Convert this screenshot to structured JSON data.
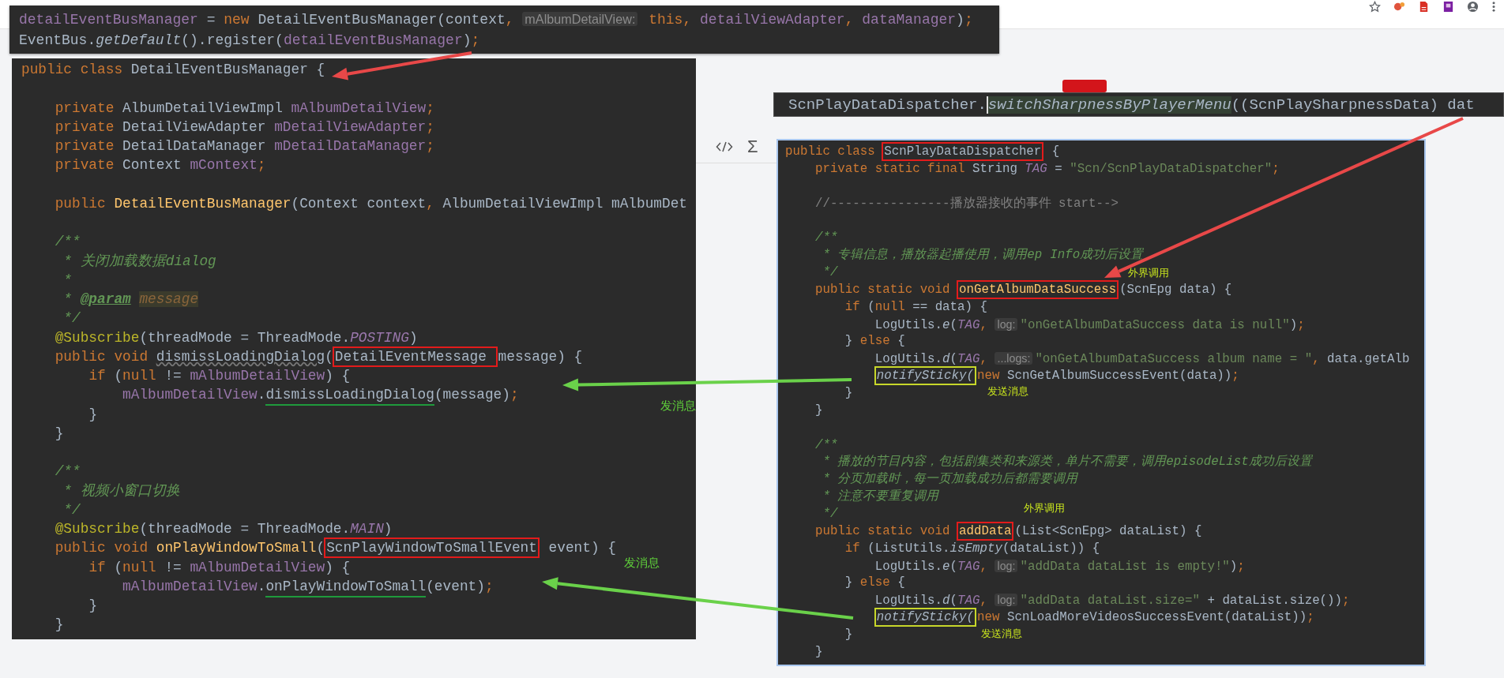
{
  "top_snippet": {
    "lines": [
      {
        "kind": "code",
        "tokens": [
          {
            "text": "detailEventBusManager",
            "kind": "field"
          },
          {
            "text": " = ",
            "kind": "plain"
          },
          {
            "text": "new ",
            "kind": "kw"
          },
          {
            "text": "DetailEventBusManager(context",
            "kind": "plain"
          },
          {
            "text": ", ",
            "kind": "kw"
          },
          {
            "text": "mAlbumDetailView:",
            "kind": "hint"
          },
          {
            "text": " this, ",
            "kind": "kw"
          },
          {
            "text": "detailViewAdapter",
            "kind": "field"
          },
          {
            "text": ", ",
            "kind": "kw"
          },
          {
            "text": "dataManager",
            "kind": "field"
          },
          {
            "text": ")",
            "kind": "plain"
          },
          {
            "text": ";",
            "kind": "kw"
          }
        ]
      },
      {
        "kind": "code",
        "tokens": [
          {
            "text": "EventBus.",
            "kind": "plain"
          },
          {
            "text": "getDefault",
            "kind": "italic"
          },
          {
            "text": "().register(",
            "kind": "plain"
          },
          {
            "text": "detailEventBusManager",
            "kind": "field"
          },
          {
            "text": ")",
            "kind": "plain"
          },
          {
            "text": ";",
            "kind": "kw"
          }
        ]
      }
    ]
  },
  "editor_toolbar": {
    "sigma": "Σ"
  },
  "call_snippet": {
    "tokens": [
      {
        "text": "ScnPlayDataDispatcher.",
        "kind": "plain"
      },
      {
        "text": "switchSharpnessByPlayerMenu",
        "kind": "selected"
      },
      {
        "text": "((ScnPlaySharpnessData) dat",
        "kind": "plain"
      }
    ]
  },
  "code_panels": [
    {
      "lines": [
        {
          "kind": "code",
          "tokens": [
            {
              "text": "public class ",
              "kind": "kw"
            },
            {
              "text": "DetailEventBusManager {",
              "kind": "plain"
            }
          ]
        },
        {
          "kind": "blank"
        },
        {
          "kind": "code",
          "tokens": [
            {
              "text": "    private ",
              "kind": "kw"
            },
            {
              "text": "AlbumDetailViewImpl ",
              "kind": "plain"
            },
            {
              "text": "mAlbumDetailView",
              "kind": "field"
            },
            {
              "text": ";",
              "kind": "kw"
            }
          ]
        },
        {
          "kind": "code",
          "tokens": [
            {
              "text": "    private ",
              "kind": "kw"
            },
            {
              "text": "DetailViewAdapter ",
              "kind": "plain"
            },
            {
              "text": "mDetailViewAdapter",
              "kind": "field"
            },
            {
              "text": ";",
              "kind": "kw"
            }
          ]
        },
        {
          "kind": "code",
          "tokens": [
            {
              "text": "    private ",
              "kind": "kw"
            },
            {
              "text": "DetailDataManager ",
              "kind": "plain"
            },
            {
              "text": "mDetailDataManager",
              "kind": "field"
            },
            {
              "text": ";",
              "kind": "kw"
            }
          ]
        },
        {
          "kind": "code",
          "tokens": [
            {
              "text": "    private ",
              "kind": "kw"
            },
            {
              "text": "Context ",
              "kind": "plain"
            },
            {
              "text": "mContext",
              "kind": "field"
            },
            {
              "text": ";",
              "kind": "kw"
            }
          ]
        },
        {
          "kind": "blank"
        },
        {
          "kind": "code",
          "tokens": [
            {
              "text": "    public ",
              "kind": "kw"
            },
            {
              "text": "DetailEventBusManager",
              "kind": "method"
            },
            {
              "text": "(Context context",
              "kind": "plain"
            },
            {
              "text": ", ",
              "kind": "kw"
            },
            {
              "text": "AlbumDetailViewImpl mAlbumDet",
              "kind": "plain"
            }
          ]
        },
        {
          "kind": "blank"
        },
        {
          "kind": "code",
          "tokens": [
            {
              "text": "    /**",
              "kind": "doc"
            }
          ]
        },
        {
          "kind": "code",
          "tokens": [
            {
              "text": "     * 关闭加载数据dialog",
              "kind": "doc"
            }
          ]
        },
        {
          "kind": "code",
          "tokens": [
            {
              "text": "     *",
              "kind": "doc"
            }
          ]
        },
        {
          "kind": "code",
          "tokens": [
            {
              "text": "     * ",
              "kind": "doc"
            },
            {
              "text": "@param",
              "kind": "doctag"
            },
            {
              "text": "message",
              "kind": "docparam"
            }
          ]
        },
        {
          "kind": "code",
          "tokens": [
            {
              "text": "     */",
              "kind": "doc"
            }
          ]
        },
        {
          "kind": "code",
          "tokens": [
            {
              "text": "    @Subscribe",
              "kind": "annot"
            },
            {
              "text": "(threadMode = ThreadMode.",
              "kind": "plain"
            },
            {
              "text": "POSTING",
              "kind": "static"
            },
            {
              "text": ")",
              "kind": "plain"
            }
          ]
        },
        {
          "kind": "code",
          "tokens": [
            {
              "text": "    public void ",
              "kind": "kw"
            },
            {
              "text": "dismissLoadingDialog",
              "kind": "unused"
            },
            {
              "text": "(",
              "kind": "plain"
            },
            {
              "text": "DetailEventMessage ",
              "kind": "plain",
              "color": "#e31b1b"
            },
            {
              "text": "message) {",
              "kind": "plain"
            }
          ]
        },
        {
          "kind": "code",
          "tokens": [
            {
              "text": "        if ",
              "kind": "kw"
            },
            {
              "text": "(",
              "kind": "plain"
            },
            {
              "text": "null ",
              "kind": "kw"
            },
            {
              "text": "!= ",
              "kind": "plain"
            },
            {
              "text": "mAlbumDetailView",
              "kind": "field"
            },
            {
              "text": ") {",
              "kind": "plain"
            }
          ]
        },
        {
          "kind": "code",
          "tokens": [
            {
              "text": "            mAlbumDetailView",
              "kind": "field"
            },
            {
              "text": ".",
              "kind": "plain"
            },
            {
              "text": "dismissLoadingDialog",
              "kind": "plain",
              "underlined": true
            },
            {
              "text": "(message)",
              "kind": "plain"
            },
            {
              "text": ";",
              "kind": "kw"
            }
          ]
        },
        {
          "kind": "code",
          "tokens": [
            {
              "text": "        }",
              "kind": "plain"
            }
          ]
        },
        {
          "kind": "code",
          "tokens": [
            {
              "text": "    }",
              "kind": "plain"
            }
          ]
        },
        {
          "kind": "blank"
        },
        {
          "kind": "code",
          "tokens": [
            {
              "text": "    /**",
              "kind": "doc"
            }
          ]
        },
        {
          "kind": "code",
          "tokens": [
            {
              "text": "     * 视频小窗口切换",
              "kind": "doc"
            }
          ]
        },
        {
          "kind": "code",
          "tokens": [
            {
              "text": "     */",
              "kind": "doc"
            }
          ]
        },
        {
          "kind": "code",
          "tokens": [
            {
              "text": "    @Subscribe",
              "kind": "annot"
            },
            {
              "text": "(threadMode = ThreadMode.",
              "kind": "plain"
            },
            {
              "text": "MAIN",
              "kind": "static"
            },
            {
              "text": ")",
              "kind": "plain"
            }
          ]
        },
        {
          "kind": "code",
          "tokens": [
            {
              "text": "    public void ",
              "kind": "kw"
            },
            {
              "text": "onPlayWindowToSmall",
              "kind": "method"
            },
            {
              "text": "(",
              "kind": "plain"
            },
            {
              "text": "ScnPlayWindowToSmallEvent",
              "kind": "plain",
              "color": "#e31b1b"
            },
            {
              "text": " event) {",
              "kind": "plain"
            }
          ]
        },
        {
          "kind": "code",
          "tokens": [
            {
              "text": "        if ",
              "kind": "kw"
            },
            {
              "text": "(",
              "kind": "plain"
            },
            {
              "text": "null ",
              "kind": "kw"
            },
            {
              "text": "!= ",
              "kind": "plain"
            },
            {
              "text": "mAlbumDetailView",
              "kind": "field"
            },
            {
              "text": ") {",
              "kind": "plain"
            }
          ]
        },
        {
          "kind": "code",
          "tokens": [
            {
              "text": "            mAlbumDetailView",
              "kind": "field"
            },
            {
              "text": ".",
              "kind": "plain"
            },
            {
              "text": "onPlayWindowToSmall",
              "kind": "plain",
              "underlined": true
            },
            {
              "text": "(event)",
              "kind": "plain"
            },
            {
              "text": ";",
              "kind": "kw"
            }
          ]
        },
        {
          "kind": "code",
          "tokens": [
            {
              "text": "        }",
              "kind": "plain"
            }
          ]
        },
        {
          "kind": "code",
          "tokens": [
            {
              "text": "    }",
              "kind": "plain"
            }
          ]
        }
      ]
    },
    {
      "lines": [
        {
          "kind": "code",
          "tokens": [
            {
              "text": "public class ",
              "kind": "kw"
            },
            {
              "text": "ScnPlayDataDispatcher",
              "kind": "plain",
              "color": "#e31b1b"
            },
            {
              "text": " {",
              "kind": "plain"
            }
          ]
        },
        {
          "kind": "code",
          "tokens": [
            {
              "text": "    private static final ",
              "kind": "kw"
            },
            {
              "text": "String ",
              "kind": "plain"
            },
            {
              "text": "TAG",
              "kind": "static"
            },
            {
              "text": " = ",
              "kind": "plain"
            },
            {
              "text": "\"Scn/ScnPlayDataDispatcher\"",
              "kind": "str"
            },
            {
              "text": ";",
              "kind": "kw"
            }
          ]
        },
        {
          "kind": "blank"
        },
        {
          "kind": "code",
          "tokens": [
            {
              "text": "    //----------------播放器接收的事件 start-->",
              "kind": "cmt"
            }
          ]
        },
        {
          "kind": "blank"
        },
        {
          "kind": "code",
          "tokens": [
            {
              "text": "    /**",
              "kind": "doc"
            }
          ]
        },
        {
          "kind": "code",
          "tokens": [
            {
              "text": "     * 专辑信息，播放器起播使用，调用ep",
              "kind": "doc"
            },
            {
              "text": "Info成功后设置",
              "kind": "doc",
              "covered_before": true
            }
          ]
        },
        {
          "kind": "code",
          "tokens": [
            {
              "text": "     */",
              "kind": "doc"
            }
          ]
        },
        {
          "kind": "code",
          "tokens": [
            {
              "text": "    public static void ",
              "kind": "kw"
            },
            {
              "text": "onGetAlbumDataSuccess",
              "kind": "method",
              "color": "#e31b1b"
            },
            {
              "text": "(ScnEpg data) {",
              "kind": "plain"
            }
          ]
        },
        {
          "kind": "code",
          "tokens": [
            {
              "text": "        if ",
              "kind": "kw"
            },
            {
              "text": "(",
              "kind": "plain"
            },
            {
              "text": "null ",
              "kind": "kw"
            },
            {
              "text": "== data) {",
              "kind": "plain"
            }
          ]
        },
        {
          "kind": "code",
          "tokens": [
            {
              "text": "            LogUtils.",
              "kind": "plain"
            },
            {
              "text": "e",
              "kind": "italic"
            },
            {
              "text": "(",
              "kind": "plain"
            },
            {
              "text": "TAG",
              "kind": "static"
            },
            {
              "text": ", ",
              "kind": "kw"
            },
            {
              "text": "log:",
              "kind": "hint"
            },
            {
              "text": "\"onGetAlbumDataSuccess data is null\"",
              "kind": "str"
            },
            {
              "text": ")",
              "kind": "plain"
            },
            {
              "text": ";",
              "kind": "kw"
            }
          ]
        },
        {
          "kind": "code",
          "tokens": [
            {
              "text": "        } ",
              "kind": "plain"
            },
            {
              "text": "else ",
              "kind": "kw"
            },
            {
              "text": "{",
              "kind": "plain"
            }
          ]
        },
        {
          "kind": "code",
          "tokens": [
            {
              "text": "            LogUtils.",
              "kind": "plain"
            },
            {
              "text": "d",
              "kind": "italic"
            },
            {
              "text": "(",
              "kind": "plain"
            },
            {
              "text": "TAG",
              "kind": "static"
            },
            {
              "text": ", ",
              "kind": "kw"
            },
            {
              "text": "...logs:",
              "kind": "hint"
            },
            {
              "text": "\"onGetAlbumDataSuccess album name = \"",
              "kind": "str"
            },
            {
              "text": ", ",
              "kind": "kw"
            },
            {
              "text": "data.getAlb",
              "kind": "plain"
            }
          ]
        },
        {
          "kind": "code",
          "tokens": [
            {
              "text": "            notifySticky(",
              "kind": "italic",
              "color": "#c7d72a"
            },
            {
              "text": "new ",
              "kind": "kw"
            },
            {
              "text": "ScnGetAlbumSuccessEvent(data))",
              "kind": "plain"
            },
            {
              "text": ";",
              "kind": "kw"
            }
          ]
        },
        {
          "kind": "code",
          "tokens": [
            {
              "text": "        }",
              "kind": "plain"
            }
          ]
        },
        {
          "kind": "code",
          "tokens": [
            {
              "text": "    }",
              "kind": "plain"
            }
          ]
        },
        {
          "kind": "blank"
        },
        {
          "kind": "code",
          "tokens": [
            {
              "text": "    /**",
              "kind": "doc"
            }
          ]
        },
        {
          "kind": "code",
          "tokens": [
            {
              "text": "     * 播放的节目内容，包括剧集类和来源类，单片不需要，调用episodeList成功后设置",
              "kind": "doc"
            }
          ]
        },
        {
          "kind": "code",
          "tokens": [
            {
              "text": "     * 分页加载时，每一页加载成功后都需要调用",
              "kind": "doc"
            }
          ]
        },
        {
          "kind": "code",
          "tokens": [
            {
              "text": "     * 注意不要重复调用",
              "kind": "doc"
            }
          ]
        },
        {
          "kind": "code",
          "tokens": [
            {
              "text": "     */",
              "kind": "doc"
            }
          ]
        },
        {
          "kind": "code",
          "tokens": [
            {
              "text": "    public static void ",
              "kind": "kw"
            },
            {
              "text": "addData",
              "kind": "method",
              "color": "#e31b1b"
            },
            {
              "text": "(List<ScnEpg> dataList) {",
              "kind": "plain"
            }
          ]
        },
        {
          "kind": "code",
          "tokens": [
            {
              "text": "        if ",
              "kind": "kw"
            },
            {
              "text": "(ListUtils.",
              "kind": "plain"
            },
            {
              "text": "isEmpty",
              "kind": "italic"
            },
            {
              "text": "(dataList)) {",
              "kind": "plain"
            }
          ]
        },
        {
          "kind": "code",
          "tokens": [
            {
              "text": "            LogUtils.",
              "kind": "plain"
            },
            {
              "text": "e",
              "kind": "italic"
            },
            {
              "text": "(",
              "kind": "plain"
            },
            {
              "text": "TAG",
              "kind": "static"
            },
            {
              "text": ", ",
              "kind": "kw"
            },
            {
              "text": "log:",
              "kind": "hint"
            },
            {
              "text": "\"addData dataList is empty!\"",
              "kind": "str"
            },
            {
              "text": ")",
              "kind": "plain"
            },
            {
              "text": ";",
              "kind": "kw"
            }
          ]
        },
        {
          "kind": "code",
          "tokens": [
            {
              "text": "        } ",
              "kind": "plain"
            },
            {
              "text": "else ",
              "kind": "kw"
            },
            {
              "text": "{",
              "kind": "plain"
            }
          ]
        },
        {
          "kind": "code",
          "tokens": [
            {
              "text": "            LogUtils.",
              "kind": "plain"
            },
            {
              "text": "d",
              "kind": "italic"
            },
            {
              "text": "(",
              "kind": "plain"
            },
            {
              "text": "TAG",
              "kind": "static"
            },
            {
              "text": ", ",
              "kind": "kw"
            },
            {
              "text": "log:",
              "kind": "hint"
            },
            {
              "text": "\"addData dataList.size=\"",
              "kind": "str"
            },
            {
              "text": " + dataList.size())",
              "kind": "plain"
            },
            {
              "text": ";",
              "kind": "kw"
            }
          ]
        },
        {
          "kind": "code",
          "tokens": [
            {
              "text": "            notifySticky(",
              "kind": "italic",
              "color": "#c7d72a"
            },
            {
              "text": "new ",
              "kind": "kw"
            },
            {
              "text": "ScnLoadMoreVideosSuccessEvent(dataList))",
              "kind": "plain"
            },
            {
              "text": ";",
              "kind": "kw"
            }
          ]
        },
        {
          "kind": "code",
          "tokens": [
            {
              "text": "        }",
              "kind": "plain"
            }
          ]
        },
        {
          "kind": "code",
          "tokens": [
            {
              "text": "    }",
              "kind": "plain"
            }
          ]
        }
      ]
    }
  ],
  "annotation_labels": [
    {
      "text": "外界调用",
      "kind": "callout"
    },
    {
      "text": "发送消息",
      "kind": "callout"
    },
    {
      "text": "发消息",
      "kind": "note"
    },
    {
      "text": "外界调用",
      "kind": "callout"
    },
    {
      "text": "发消息",
      "kind": "note"
    },
    {
      "text": "发送消息",
      "kind": "callout"
    }
  ]
}
